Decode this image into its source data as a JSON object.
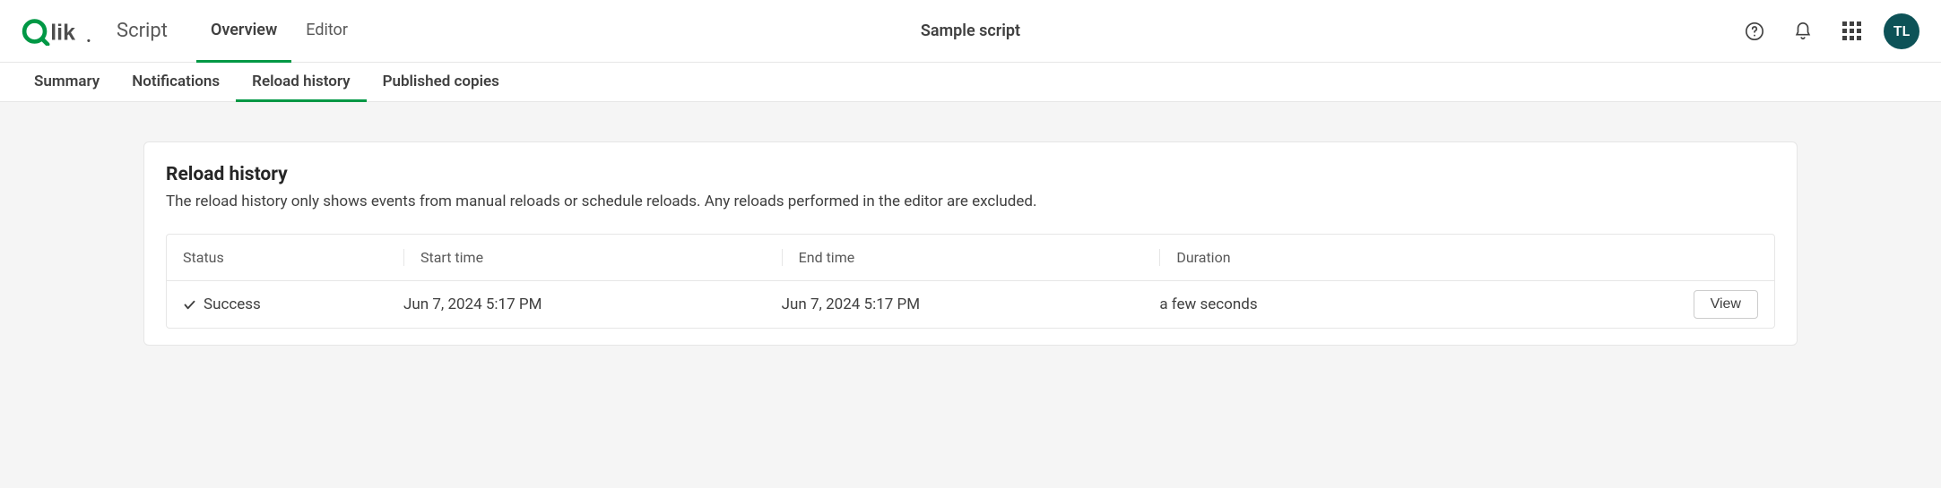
{
  "brand": {
    "name": "Qlik",
    "accent": "#009845"
  },
  "app_label": "Script",
  "primary_tabs": [
    {
      "label": "Overview",
      "active": true
    },
    {
      "label": "Editor",
      "active": false
    }
  ],
  "page_title": "Sample script",
  "avatar_initials": "TL",
  "sub_tabs": [
    {
      "label": "Summary",
      "active": false
    },
    {
      "label": "Notifications",
      "active": false
    },
    {
      "label": "Reload history",
      "active": true
    },
    {
      "label": "Published copies",
      "active": false
    }
  ],
  "panel": {
    "title": "Reload history",
    "description": "The reload history only shows events from manual reloads or schedule reloads. Any reloads performed in the editor are excluded."
  },
  "table": {
    "columns": {
      "status": "Status",
      "start": "Start time",
      "end": "End time",
      "duration": "Duration"
    },
    "rows": [
      {
        "status": "Success",
        "start": "Jun 7, 2024 5:17 PM",
        "end": "Jun 7, 2024 5:17 PM",
        "duration": "a few seconds",
        "action": "View"
      }
    ]
  }
}
